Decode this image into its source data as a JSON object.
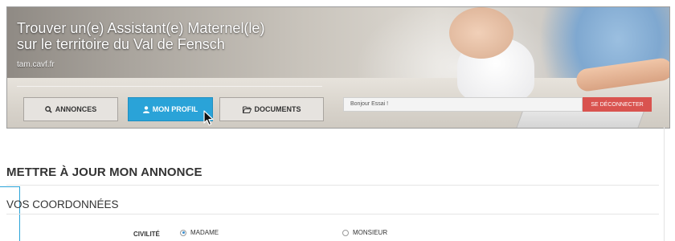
{
  "header": {
    "title_line1": "Trouver un(e) Assistant(e) Maternel(le)",
    "title_line2": "sur le territoire du Val de Fensch",
    "url": "tam.cavf.fr"
  },
  "nav": {
    "tabs": [
      {
        "label": "ANNONCES",
        "icon": "search-icon",
        "active": false
      },
      {
        "label": "MON PROFIL",
        "icon": "user-icon",
        "active": true
      },
      {
        "label": "DOCUMENTS",
        "icon": "folder-open-icon",
        "active": false
      }
    ]
  },
  "user_bar": {
    "greeting": "Bonjour Essai !",
    "logout_label": "SE DÉCONNECTER"
  },
  "main": {
    "page_title": "METTRE À JOUR MON ANNONCE",
    "section_title": "VOS COORDONNÉES",
    "civilite": {
      "label": "CIVILITÉ",
      "options": [
        {
          "label": "MADAME",
          "checked": true
        },
        {
          "label": "MONSIEUR",
          "checked": false
        }
      ]
    }
  },
  "colors": {
    "accent_blue": "#2aa3d8",
    "logout_red": "#d9534f",
    "tab_grey": "#e6e3df",
    "text_dark": "#333333"
  }
}
